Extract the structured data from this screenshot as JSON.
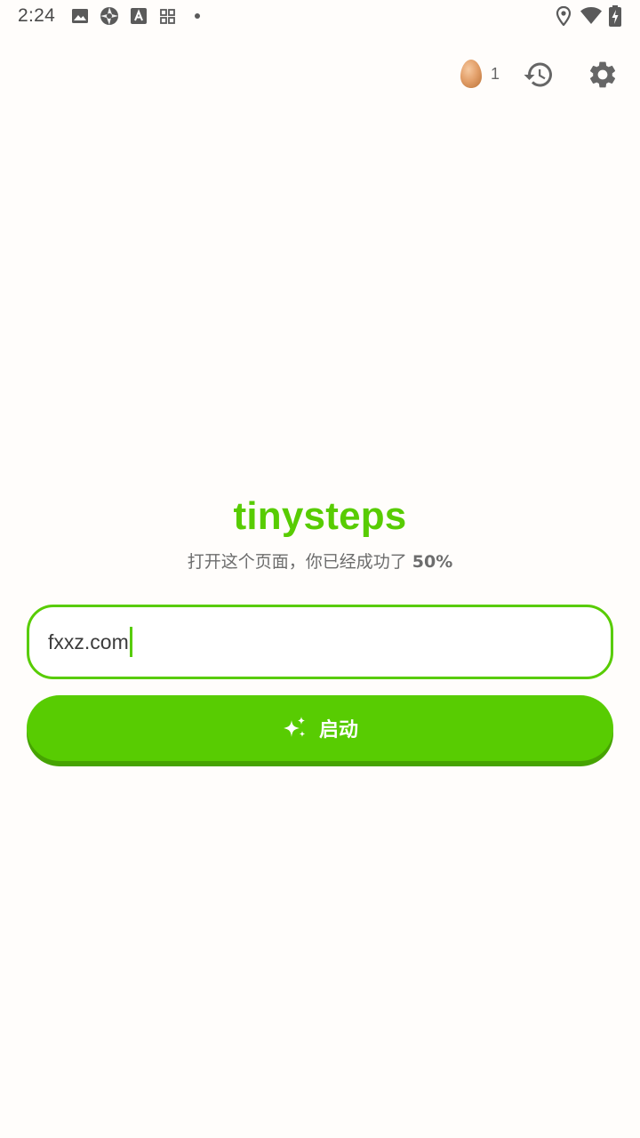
{
  "status_bar": {
    "time": "2:24",
    "left_icons": [
      "gallery-icon",
      "aperture-icon",
      "font-a-icon",
      "qr-grid-icon",
      "dot-icon"
    ],
    "right_icons": [
      "location-icon",
      "wifi-icon",
      "battery-charging-icon"
    ]
  },
  "header": {
    "egg_count": "1",
    "icons": [
      "egg-icon",
      "history-icon",
      "settings-gear-icon"
    ]
  },
  "brand": {
    "title": "tinysteps",
    "subtitle_text": "打开这个页面，你已经成功了",
    "subtitle_percent": "50%"
  },
  "url_input": {
    "value": "fxxz.com"
  },
  "launch_button": {
    "label": "启动",
    "icon": "sparkle-icon"
  },
  "colors": {
    "brand_green": "#58cc02",
    "button_shadow": "#46a302",
    "background": "#fffdfb",
    "text_gray": "#6d6d6d"
  }
}
